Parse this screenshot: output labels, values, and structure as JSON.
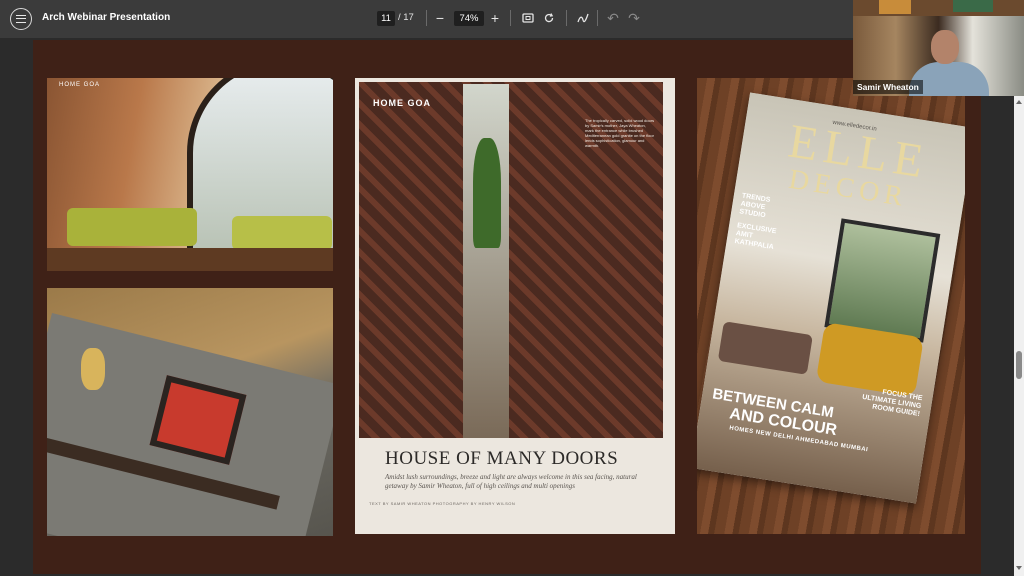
{
  "toolbar": {
    "title": "Arch Webinar Presentation",
    "current_page": "11",
    "total_pages": "/ 17",
    "zoom": "74%"
  },
  "slide": {
    "photo1": {
      "tag": "HOME GOA"
    },
    "photo3": {
      "tag": "HOME GOA",
      "caption": "The tropically carved, solid wood doors by Samir's mother, Jaya Wheaton, mark the entrance while brushed Mediterranean gold granite on the floor lends sophistication, glamour and warmth.",
      "headline": "HOUSE OF MANY DOORS",
      "deck": "Amidst lush surroundings, breeze and light are always welcome in this sea facing, natural getaway by Samir Wheaton, full of high ceilings and multi openings",
      "credit": "TEXT BY SAMIR WHEATON   PHOTOGRAPHY BY HENRY WILSON"
    },
    "photo4": {
      "url": "www.elledecor.in",
      "masthead": "ELLE",
      "masthead2": "DECOR",
      "trends": "TRENDS ABOVE STUDIO",
      "exclusive": "EXCLUSIVE AMIT KATHPALIA",
      "focus": "FOCUS THE ULTIMATE LIVING ROOM GUIDE!",
      "headline1": "BETWEEN CALM",
      "headline2": "AND COLOUR",
      "cities": "HOMES NEW DELHI AHMEDABAD MUMBAI"
    }
  },
  "participant": {
    "name": "Samir Wheaton"
  },
  "icons": {
    "menu": "menu-icon",
    "zoom_out": "minus-icon",
    "zoom_in": "plus-icon",
    "fit_page": "fit-page-icon",
    "rotate": "rotate-icon",
    "draw": "draw-icon",
    "undo": "undo-icon",
    "redo": "redo-icon"
  }
}
